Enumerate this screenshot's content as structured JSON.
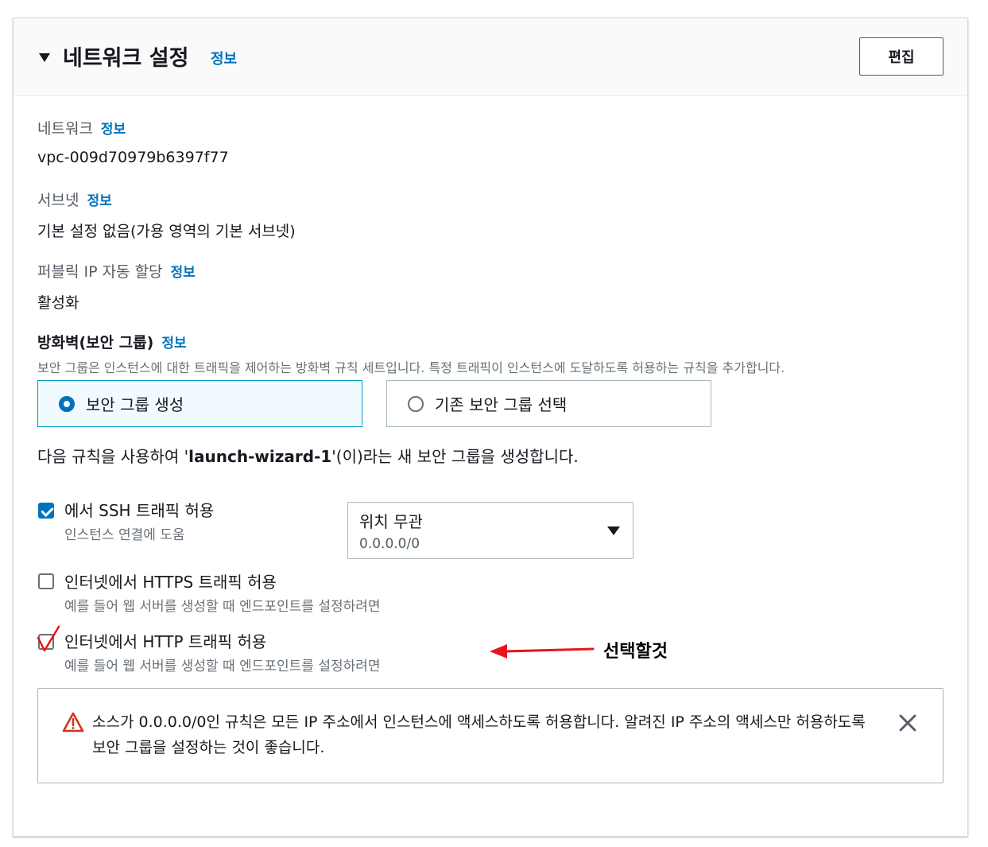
{
  "header": {
    "title": "네트워크 설정",
    "info": "정보",
    "edit_label": "편집"
  },
  "network": {
    "label": "네트워크",
    "info": "정보",
    "value": "vpc-009d70979b6397f77"
  },
  "subnet": {
    "label": "서브넷",
    "info": "정보",
    "value": "기본 설정 없음(가용 영역의 기본 서브넷)"
  },
  "public_ip": {
    "label": "퍼블릭 IP 자동 할당",
    "info": "정보",
    "value": "활성화"
  },
  "firewall": {
    "label": "방화벽(보안 그룹)",
    "info": "정보",
    "description": "보안 그룹은 인스턴스에 대한 트래픽을 제어하는 방화벽 규칙 세트입니다. 특정 트래픽이 인스턴스에 도달하도록 허용하는 규칙을 추가합니다.",
    "options": [
      {
        "label": "보안 그룹 생성",
        "selected": true
      },
      {
        "label": "기존 보안 그룹 선택",
        "selected": false
      }
    ],
    "create_sentence_pre": "다음 규칙을 사용하여 '",
    "create_sentence_name": "launch-wizard-1",
    "create_sentence_post": "'(이)라는 새 보안 그룹을 생성합니다."
  },
  "rules": [
    {
      "label": "에서 SSH 트래픽 허용",
      "description": "인스턴스 연결에 도움",
      "checked": true
    },
    {
      "label": "인터넷에서 HTTPS 트래픽 허용",
      "description": "예를 들어 웹 서버를 생성할 때 엔드포인트를 설정하려면",
      "checked": false
    },
    {
      "label": "인터넷에서 HTTP 트래픽 허용",
      "description": "예를 들어 웹 서버를 생성할 때 엔드포인트를 설정하려면",
      "checked": false
    }
  ],
  "source_select": {
    "value": "위치 무관",
    "sub": "0.0.0.0/0"
  },
  "alert": {
    "text": "소스가 0.0.0.0/0인 규칙은 모든 IP 주소에서 인스턴스에 액세스하도록 허용합니다. 알려진 IP 주소의 액세스만 허용하도록 보안 그룹을 설정하는 것이 좋습니다."
  },
  "annotation": {
    "text": "선택할것",
    "color": "#e8141c"
  },
  "colors": {
    "link": "#0073bb",
    "selected_bg": "#f1faff",
    "warning": "#d13212"
  }
}
